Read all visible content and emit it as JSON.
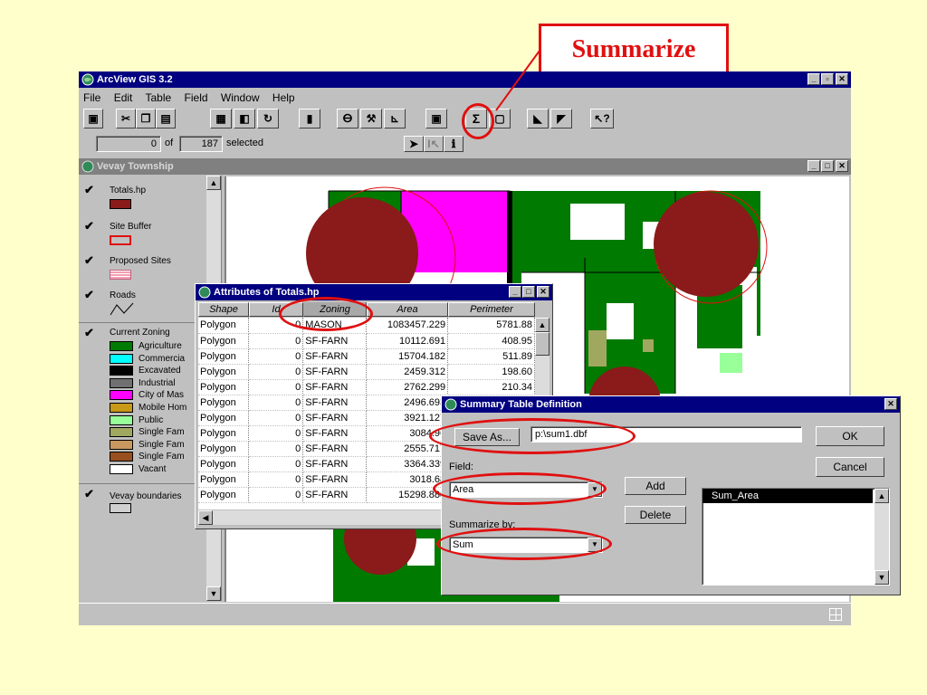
{
  "callout": {
    "label": "Summarize"
  },
  "app": {
    "title": "ArcView GIS 3.2"
  },
  "menu": [
    "File",
    "Edit",
    "Table",
    "Field",
    "Window",
    "Help"
  ],
  "toolbar": {
    "sigma": "Σ"
  },
  "selection": {
    "selected_count": "0",
    "of_label": "of",
    "total_count": "187",
    "selected_label": "selected"
  },
  "view": {
    "title": "Vevay Township"
  },
  "legend": [
    {
      "label": "Totals.hp"
    },
    {
      "label": "Site Buffer"
    },
    {
      "label": "Proposed Sites"
    },
    {
      "label": "Roads"
    },
    {
      "label": "Current Zoning",
      "classes": [
        {
          "label": "Agriculture",
          "color": "#007A00"
        },
        {
          "label": "Commercia",
          "color": "#00FFFF"
        },
        {
          "label": "Excavated",
          "color": "#000000"
        },
        {
          "label": "Industrial",
          "color": "#707070"
        },
        {
          "label": "City of Mas",
          "color": "#FF00FF"
        },
        {
          "label": "Mobile Hom",
          "color": "#C89818"
        },
        {
          "label": "Public",
          "color": "#99FF99"
        },
        {
          "label": "Single Fam",
          "color": "#A0A860"
        },
        {
          "label": "Single Fam",
          "color": "#C89860"
        },
        {
          "label": "Single Fam",
          "color": "#985020"
        },
        {
          "label": "Vacant",
          "color": "#FFFFFF"
        }
      ]
    },
    {
      "label": "Vevay boundaries"
    }
  ],
  "attributes": {
    "title": "Attributes of Totals.hp",
    "columns": [
      "Shape",
      "Id",
      "Zoning",
      "Area",
      "Perimeter"
    ],
    "rows": [
      [
        "Polygon",
        "0",
        "MASON",
        "1083457.229",
        "5781.88"
      ],
      [
        "Polygon",
        "0",
        "SF-FARN",
        "10112.691",
        "408.95"
      ],
      [
        "Polygon",
        "0",
        "SF-FARN",
        "15704.182",
        "511.89"
      ],
      [
        "Polygon",
        "0",
        "SF-FARN",
        "2459.312",
        "198.60"
      ],
      [
        "Polygon",
        "0",
        "SF-FARN",
        "2762.299",
        "210.34"
      ],
      [
        "Polygon",
        "0",
        "SF-FARN",
        "2496.693",
        ""
      ],
      [
        "Polygon",
        "0",
        "SF-FARN",
        "3921.127",
        ""
      ],
      [
        "Polygon",
        "0",
        "SF-FARN",
        "3084.96",
        ""
      ],
      [
        "Polygon",
        "0",
        "SF-FARN",
        "2555.717",
        ""
      ],
      [
        "Polygon",
        "0",
        "SF-FARN",
        "3364.339",
        ""
      ],
      [
        "Polygon",
        "0",
        "SF-FARN",
        "3018.68",
        ""
      ],
      [
        "Polygon",
        "0",
        "SF-FARN",
        "15298.888",
        ""
      ]
    ]
  },
  "summary_dialog": {
    "title": "Summary Table Definition",
    "save_as_label": "Save As...",
    "file_value": "p:\\sum1.dbf",
    "ok_label": "OK",
    "cancel_label": "Cancel",
    "field_label": "Field:",
    "field_value": "Area",
    "summarize_label": "Summarize by:",
    "summarize_value": "Sum",
    "add_label": "Add",
    "delete_label": "Delete",
    "list_items": [
      "Sum_Area"
    ]
  },
  "colors": {
    "highlight": "#E01010",
    "desktop": "#FFFFCC",
    "titlebar": "#000080"
  }
}
